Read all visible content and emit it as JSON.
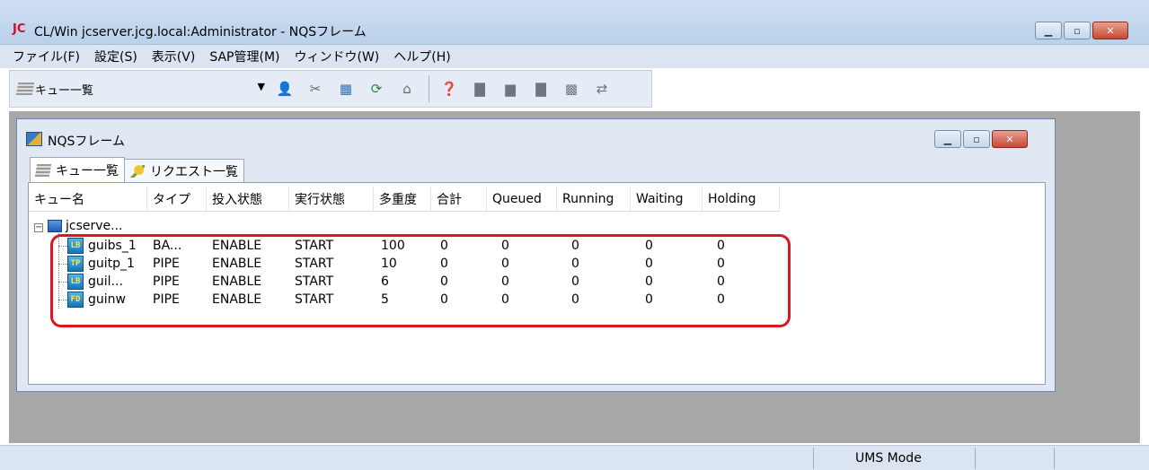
{
  "window": {
    "logo": "JC",
    "title": "CL/Win jcserver.jcg.local:Administrator - NQSフレーム",
    "buttons": [
      "minimize",
      "maximize",
      "close"
    ]
  },
  "menu": [
    "ファイル(F)",
    "設定(S)",
    "表示(V)",
    "SAP管理(M)",
    "ウィンドウ(W)",
    "ヘルプ(H)"
  ],
  "toolbar": {
    "view_select": "キュー一覧",
    "icons": [
      "user-icon",
      "tools-icon",
      "queue-config-icon",
      "refresh-icon",
      "lock-icon",
      "help-icon",
      "doc-icon",
      "doc-stack-icon",
      "doc-edit-icon",
      "job-icon",
      "transfer-icon"
    ]
  },
  "child_window": {
    "title": "NQSフレーム",
    "tabs": [
      {
        "label": "キュー一覧",
        "active": true
      },
      {
        "label": "リクエスト一覧",
        "active": false
      }
    ],
    "columns": [
      "キュー名",
      "タイプ",
      "投入状態",
      "実行状態",
      "多重度",
      "合計",
      "Queued",
      "Running",
      "Waiting",
      "Holding"
    ],
    "server": "jcserve...",
    "rows": [
      {
        "icon": "LB",
        "name": "guibs_1",
        "type": "BA...",
        "submit": "ENABLE",
        "run": "START",
        "multiplicity": "100",
        "total": "0",
        "queued": "0",
        "running": "0",
        "waiting": "0",
        "holding": "0"
      },
      {
        "icon": "TP",
        "name": "guitp_1",
        "type": "PIPE",
        "submit": "ENABLE",
        "run": "START",
        "multiplicity": "10",
        "total": "0",
        "queued": "0",
        "running": "0",
        "waiting": "0",
        "holding": "0"
      },
      {
        "icon": "LB",
        "name": "guil...",
        "type": "PIPE",
        "submit": "ENABLE",
        "run": "START",
        "multiplicity": "6",
        "total": "0",
        "queued": "0",
        "running": "0",
        "waiting": "0",
        "holding": "0"
      },
      {
        "icon": "FD",
        "name": "guinw",
        "type": "PIPE",
        "submit": "ENABLE",
        "run": "START",
        "multiplicity": "5",
        "total": "0",
        "queued": "0",
        "running": "0",
        "waiting": "0",
        "holding": "0"
      }
    ]
  },
  "status": {
    "mode": "UMS Mode"
  },
  "colors": {
    "highlight": "#e0141e",
    "titlebar": "#cfdff2",
    "mdi_background": "#a8a8a8"
  }
}
